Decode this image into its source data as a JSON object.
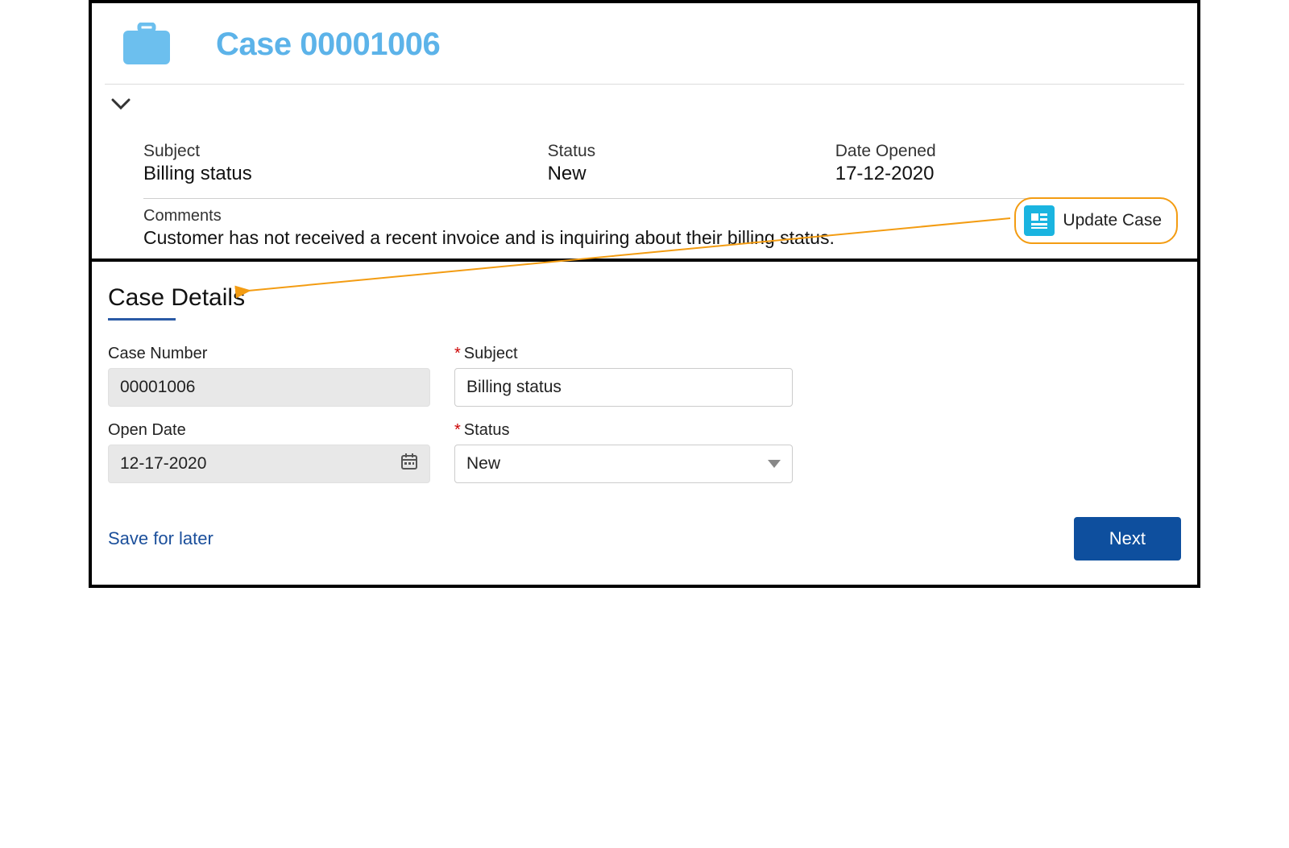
{
  "header": {
    "title": "Case 00001006"
  },
  "summary": {
    "subject_label": "Subject",
    "subject_value": "Billing status",
    "status_label": "Status",
    "status_value": "New",
    "date_label": "Date Opened",
    "date_value": "17-12-2020",
    "comments_label": "Comments",
    "comments_value": "Customer has not received a recent invoice and is inquiring about their billing status."
  },
  "actions": {
    "update_case_label": "Update Case"
  },
  "details": {
    "title": "Case Details",
    "case_number_label": "Case Number",
    "case_number_value": "00001006",
    "subject_label": "Subject",
    "subject_value": "Billing status",
    "open_date_label": "Open Date",
    "open_date_value": "12-17-2020",
    "status_label": "Status",
    "status_value": "New"
  },
  "footer": {
    "save_label": "Save for later",
    "next_label": "Next"
  }
}
